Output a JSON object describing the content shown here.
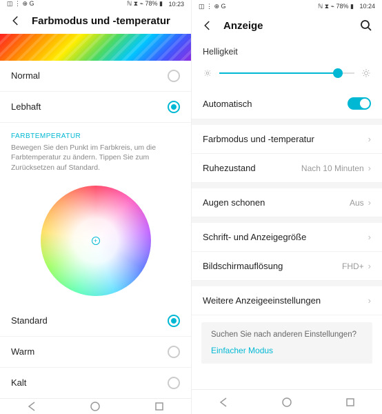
{
  "left": {
    "status": {
      "left_icons": "◫ ⋮ ⊕ G",
      "right_icons": "ℕ ⧗ ⌁ 78% ▮",
      "time": "10:23"
    },
    "title": "Farbmodus und -temperatur",
    "modes": [
      {
        "label": "Normal",
        "selected": false
      },
      {
        "label": "Lebhaft",
        "selected": true
      }
    ],
    "temp_header": "FARBTEMPERATUR",
    "temp_desc": "Bewegen Sie den Punkt im Farbkreis, um die Farbtemperatur zu ändern. Tippen Sie zum Zurücksetzen auf Standard.",
    "presets": [
      {
        "label": "Standard",
        "selected": true
      },
      {
        "label": "Warm",
        "selected": false
      },
      {
        "label": "Kalt",
        "selected": false
      }
    ]
  },
  "right": {
    "status": {
      "left_icons": "◫ ⋮ ⊕ G",
      "right_icons": "ℕ ⧗ ⌁ 78% ▮",
      "time": "10:24"
    },
    "title": "Anzeige",
    "brightness_label": "Helligkeit",
    "brightness_pct": 88,
    "auto_label": "Automatisch",
    "auto_on": true,
    "items": [
      {
        "label": "Farbmodus und -temperatur",
        "value": ""
      },
      {
        "label": "Ruhezustand",
        "value": "Nach 10 Minuten"
      }
    ],
    "items2": [
      {
        "label": "Augen schonen",
        "value": "Aus"
      }
    ],
    "items3": [
      {
        "label": "Schrift- und Anzeigegröße",
        "value": ""
      },
      {
        "label": "Bildschirmauflösung",
        "value": "FHD+"
      }
    ],
    "items4": [
      {
        "label": "Weitere Anzeigeeinstellungen",
        "value": ""
      }
    ],
    "card_q": "Suchen Sie nach anderen Einstellungen?",
    "card_link": "Einfacher Modus"
  }
}
